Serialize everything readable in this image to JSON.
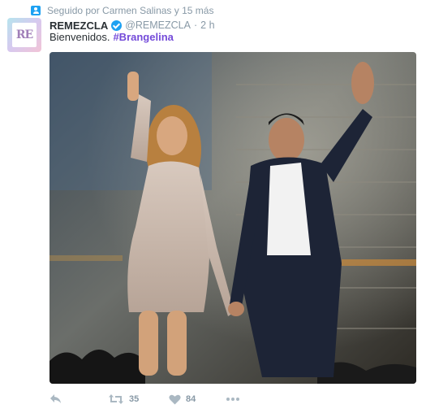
{
  "context": {
    "text": "Seguido por Carmen Salinas y 15 más",
    "icon": "person-icon"
  },
  "author": {
    "name": "REMEZCLA",
    "handle": "@REMEZCLA",
    "separator": "·",
    "time": "2 h",
    "avatar_text": "RE",
    "verified": true
  },
  "tweet": {
    "text": "Bienvenidos.",
    "hashtag": "#Brangelina",
    "hashtag_color": "#744bd9"
  },
  "photo": {
    "alt": "Woman in sequined dress and man in dark suit waving on a stage"
  },
  "actions": {
    "reply": {
      "icon": "reply-icon"
    },
    "retweet": {
      "icon": "retweet-icon",
      "count": "35"
    },
    "like": {
      "icon": "heart-icon",
      "count": "84"
    },
    "more": {
      "icon": "more-icon"
    }
  },
  "colors": {
    "accent": "#1da1f2",
    "muted": "#8899a6",
    "icon": "#aab8c2"
  }
}
